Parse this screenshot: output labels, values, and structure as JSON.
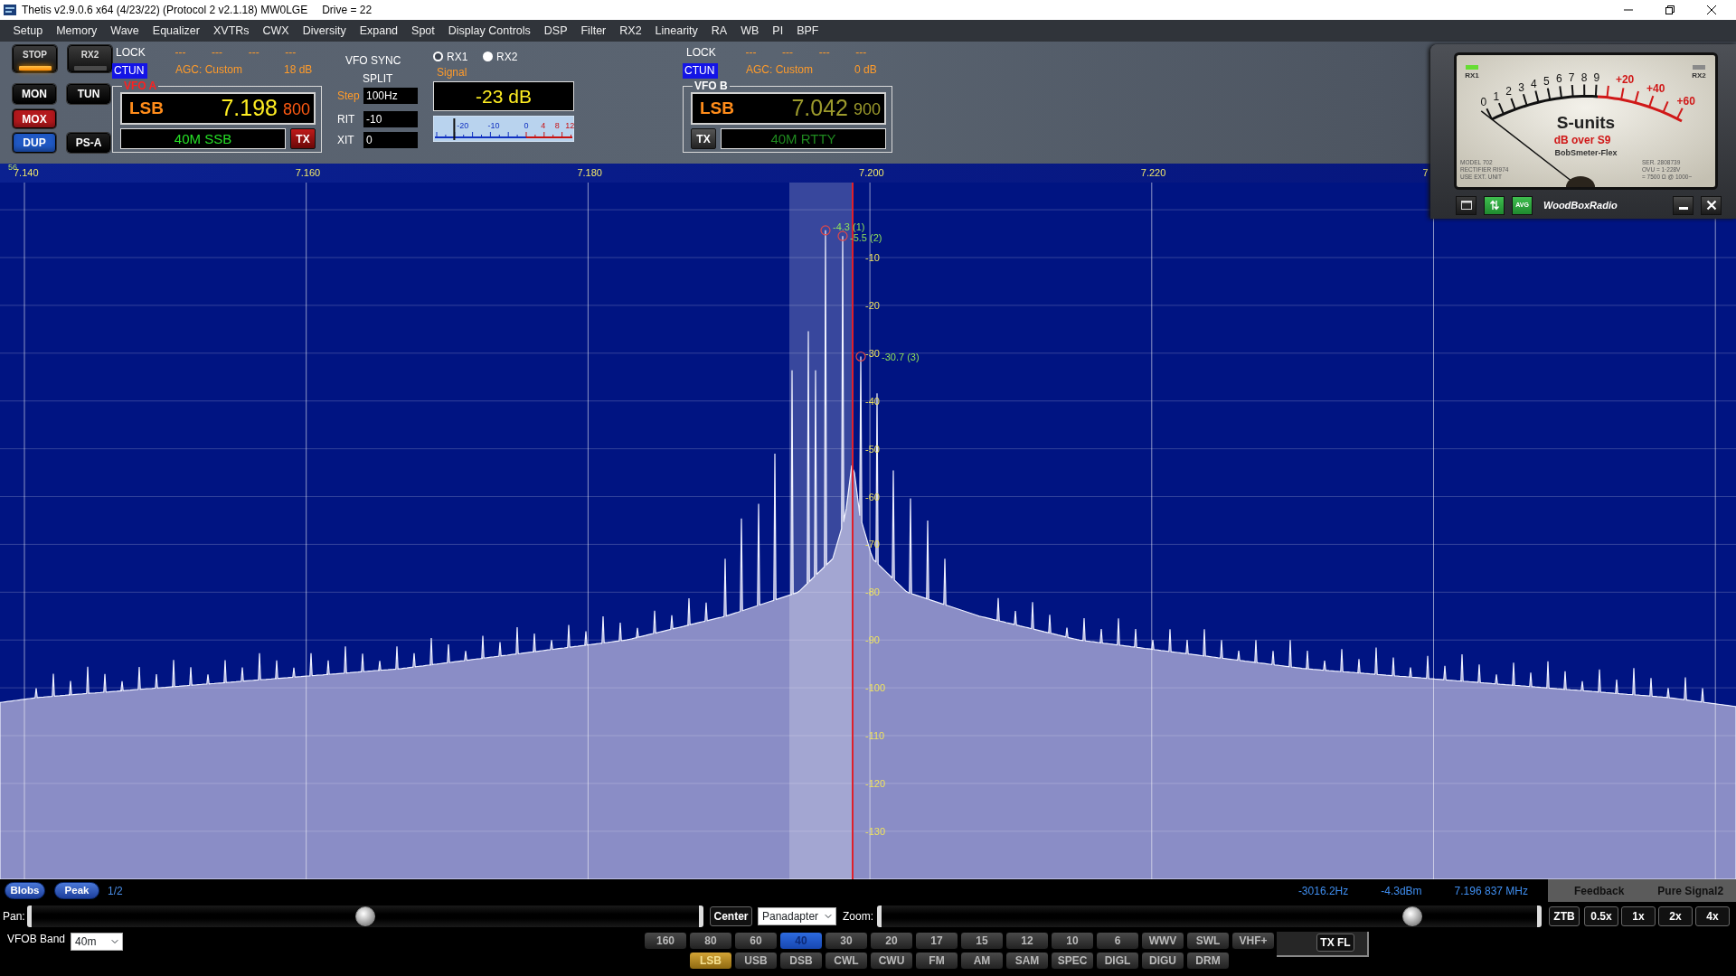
{
  "window": {
    "title": "Thetis v2.9.0.6 x64 (4/23/22) (Protocol 2 v2.1.18) MW0LGE",
    "drive": "Drive = 22"
  },
  "menu": [
    "Setup",
    "Memory",
    "Wave",
    "Equalizer",
    "XVTRs",
    "CWX",
    "Diversity",
    "Expand",
    "Spot",
    "Display Controls",
    "DSP",
    "Filter",
    "RX2",
    "Linearity",
    "RA",
    "WB",
    "PI",
    "BPF"
  ],
  "button_rows": [
    [
      {
        "label": "STOP",
        "kind": "indicator",
        "on": true
      },
      {
        "label": "RX2",
        "kind": "indicator",
        "on": false
      }
    ],
    [
      {
        "label": "MON",
        "kind": "plain",
        "on": false
      },
      {
        "label": "TUN",
        "kind": "plain",
        "on": false
      }
    ],
    [
      {
        "label": "MOX",
        "kind": "plain",
        "on": true,
        "color": "#b3181c"
      }
    ],
    [
      {
        "label": "DUP",
        "kind": "plain",
        "on": true,
        "color": "#1f58c4"
      },
      {
        "label": "PS-A",
        "kind": "plain",
        "on": false
      }
    ]
  ],
  "vfo_a": {
    "active": true,
    "lock": "LOCK",
    "dashes": [
      "---",
      "---",
      "---",
      "---"
    ],
    "ctun": {
      "label": "CTUN",
      "on": true
    },
    "agc": "AGC: Custom",
    "gain": "18 dB",
    "legend": "VFO A",
    "mode": "LSB",
    "freq": "7.198",
    "sub": "800",
    "band_mode": "40M SSB",
    "tx": {
      "label": "TX",
      "on": true
    }
  },
  "sync": {
    "vfo_sync": "VFO SYNC",
    "split": "SPLIT"
  },
  "tuning": [
    {
      "label": "Step",
      "kind": "step",
      "value": "100Hz"
    },
    {
      "label": "RIT",
      "kind": "offset",
      "value": "-10"
    },
    {
      "label": "XIT",
      "kind": "offset",
      "value": "0"
    }
  ],
  "receivers": [
    {
      "label": "RX1",
      "selected": false
    },
    {
      "label": "RX2",
      "selected": true
    }
  ],
  "signal": {
    "label": "Signal",
    "reading": "-23 dB",
    "level": 0.15,
    "scale": [
      "-20",
      "-10",
      "0",
      "4",
      "8",
      "12"
    ]
  },
  "vfo_b": {
    "active": false,
    "lock": "LOCK",
    "dashes": [
      "---",
      "---",
      "---",
      "---"
    ],
    "ctun": {
      "label": "CTUN",
      "on": true
    },
    "agc": "AGC: Custom",
    "gain": "0 dB",
    "legend": "VFO B",
    "mode": "LSB",
    "freq": "7.042",
    "sub": "900",
    "band_mode": "40M RTTY",
    "tx": {
      "label": "TX",
      "on": false
    }
  },
  "panadapter": {
    "corner_label": "56",
    "freq_labels": [
      "7.140",
      "7.160",
      "7.180",
      "7.200",
      "7.220",
      "7"
    ],
    "db_labels": [
      "-10",
      "-20",
      "-30",
      "-40",
      "-50",
      "-60",
      "-70",
      "-80",
      "-90",
      "-100",
      "-110",
      "-120",
      "-130"
    ],
    "peaks": [
      {
        "label": "-4.3 (1)"
      },
      {
        "label": "-5.5 (2)"
      },
      {
        "label": "-30.7 (3)"
      }
    ]
  },
  "meter": {
    "lamps": [
      {
        "label": "RX1",
        "on": true
      },
      {
        "label": "RX2",
        "on": false
      }
    ],
    "s_scale": [
      "0",
      "1",
      "2",
      "3",
      "4",
      "5",
      "6",
      "7",
      "8",
      "9"
    ],
    "over_scale": [
      "+20",
      "+40",
      "+60"
    ],
    "title": "S-units",
    "subtitle": "dB over S9",
    "brand": "BobSmeter-Flex",
    "plate_left": [
      "MODEL 702",
      "RECTIFIER RI974",
      "USE EXT. UNIT"
    ],
    "plate_right": [
      "SER. 2808739",
      "OVU = 1·228V",
      "= 7500 Ω @ 1000~"
    ],
    "buttons": [
      {
        "kind": "window",
        "on": false
      },
      {
        "kind": "sort",
        "on": true
      },
      {
        "kind": "avg",
        "label": "AVG",
        "on": true
      }
    ],
    "footer": "WoodBoxRadio"
  },
  "display_toggles": [
    "Blobs",
    "Peak"
  ],
  "page": "1/2",
  "readouts": [
    "-3016.2Hz",
    "-4.3dBm",
    "7.196 837 MHz"
  ],
  "ps_panel": [
    "Feedback",
    "Pure Signal2"
  ],
  "pan": {
    "label": "Pan:",
    "level": 0.5
  },
  "center": "Center",
  "display_mode": "Panadapter",
  "zoom": {
    "label": "Zoom:",
    "level": 0.81
  },
  "zoom_buttons": [
    "ZTB",
    "0.5x",
    "1x",
    "2x",
    "4x"
  ],
  "vfob_band": {
    "label": "VFOB Band",
    "value": "40m"
  },
  "bands": [
    {
      "label": "160",
      "selected": false
    },
    {
      "label": "80",
      "selected": false
    },
    {
      "label": "60",
      "selected": false
    },
    {
      "label": "40",
      "selected": true
    },
    {
      "label": "30",
      "selected": false
    },
    {
      "label": "20",
      "selected": false
    },
    {
      "label": "17",
      "selected": false
    },
    {
      "label": "15",
      "selected": false
    },
    {
      "label": "12",
      "selected": false
    },
    {
      "label": "10",
      "selected": false
    },
    {
      "label": "6",
      "selected": false
    },
    {
      "label": "WWV",
      "selected": false
    },
    {
      "label": "SWL",
      "selected": false
    },
    {
      "label": "VHF+",
      "selected": false
    }
  ],
  "tx_filter": "TX FL",
  "modes": [
    {
      "label": "LSB",
      "selected": true
    },
    {
      "label": "USB",
      "selected": false
    },
    {
      "label": "DSB",
      "selected": false
    },
    {
      "label": "CWL",
      "selected": false
    },
    {
      "label": "CWU",
      "selected": false
    },
    {
      "label": "FM",
      "selected": false
    },
    {
      "label": "AM",
      "selected": false
    },
    {
      "label": "SAM",
      "selected": false
    },
    {
      "label": "SPEC",
      "selected": false
    },
    {
      "label": "DIGL",
      "selected": false
    },
    {
      "label": "DIGU",
      "selected": false
    },
    {
      "label": "DRM",
      "selected": false
    }
  ]
}
